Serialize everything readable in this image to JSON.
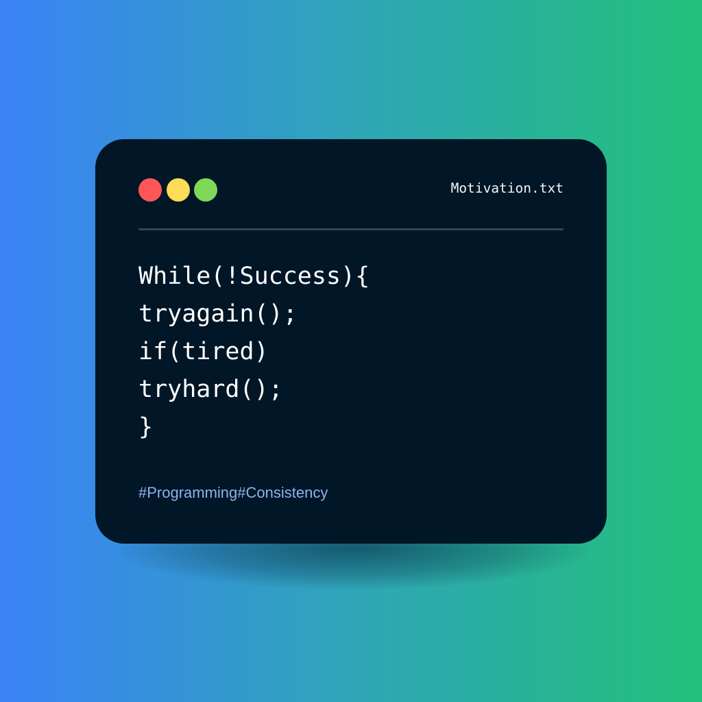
{
  "window": {
    "filename": "Motivation.txt",
    "controls": [
      {
        "name": "close",
        "color": "#ff5757"
      },
      {
        "name": "minimize",
        "color": "#ffdb58"
      },
      {
        "name": "maximize",
        "color": "#7ed957"
      }
    ]
  },
  "code": {
    "lines": [
      "While(!Success){",
      "tryagain();",
      "if(tired)",
      "tryhard();",
      "}"
    ]
  },
  "hashtags": "#Programming#Consistency"
}
